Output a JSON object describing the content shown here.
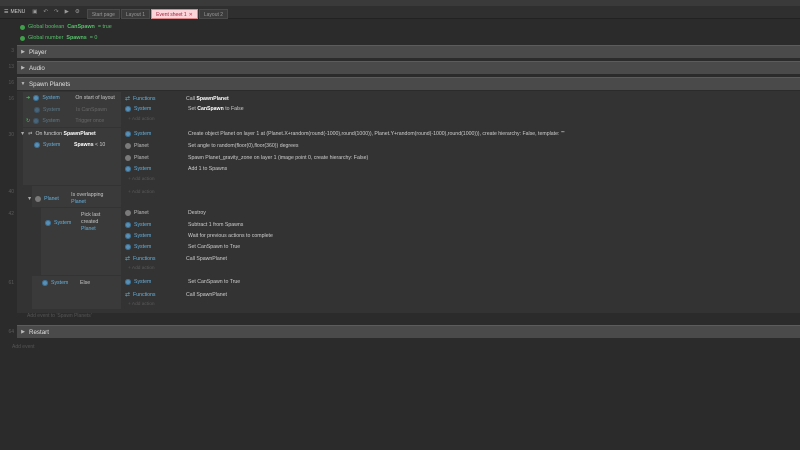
{
  "toolbar": {
    "menu_label": "MENU",
    "tabs": [
      "Start page",
      "Layout 1",
      "Event sheet 1",
      "Layout 2"
    ]
  },
  "globals": [
    {
      "text": "Global boolean ",
      "name": "CanSpawn",
      "value": " = true"
    },
    {
      "text": "Global number ",
      "name": "Spawns",
      "value": " = 0"
    }
  ],
  "line_numbers": {
    "g1": "3",
    "g2": "13",
    "g3": "16",
    "l1": "16",
    "l2": "30",
    "l3": "40",
    "l4": "42",
    "l5": "61",
    "l6": "64"
  },
  "groups": {
    "player": "Player",
    "audio": "Audio",
    "spawn": "Spawn Planets",
    "restart": "Restart"
  },
  "events": {
    "e1": {
      "conds": [
        {
          "obj": "System",
          "text": "On start of layout"
        },
        {
          "obj": "System",
          "text": "Is CanSpawn"
        },
        {
          "obj": "System",
          "text": "Trigger once"
        }
      ],
      "actions": [
        {
          "obj": "Functions",
          "pre": "Call ",
          "bold": "SpawnPlanet",
          "post": ""
        },
        {
          "obj": "System",
          "pre": "Set ",
          "bold": "CanSpawn",
          "post": " to False"
        }
      ]
    },
    "e2": {
      "header_pre": "On function ",
      "header_bold": "SpawnPlanet",
      "cond": {
        "obj": "System",
        "name": "Spawns",
        "op": " < 10"
      },
      "actions": [
        {
          "obj": "System",
          "text": "Create object  Planet on layer 1 at (Planet.X+random(round(-1000),round(1000)), Planet.Y+random(round(-1000),round(1000))), create hierarchy: False, template: \"\""
        },
        {
          "obj": "Planet",
          "text": "Set angle to random(floor(0),floor(360)) degrees"
        },
        {
          "obj": "Planet",
          "text": "Spawn     Planet_gravity_zone on layer 1 (image point 0, create hierarchy: False)"
        },
        {
          "obj": "System",
          "text": "Add 1 to Spawns"
        }
      ]
    },
    "e3": {
      "obj": "Planet",
      "text": "Is overlapping",
      "target": "Planet"
    },
    "e4": {
      "cond": {
        "obj": "System",
        "text": "Pick last created",
        "target": "Planet"
      },
      "actions": [
        {
          "obj": "Planet",
          "text": "Destroy"
        },
        {
          "obj": "System",
          "text": "Subtract 1 from Spawns"
        },
        {
          "obj": "System",
          "text": "Wait for previous actions to complete"
        },
        {
          "obj": "System",
          "text": "Set CanSpawn to True"
        },
        {
          "obj": "Functions",
          "text": "Call SpawnPlanet"
        }
      ]
    },
    "e5": {
      "cond": {
        "obj": "System",
        "text": "Else"
      },
      "actions": [
        {
          "obj": "System",
          "text": "Set CanSpawn to True"
        },
        {
          "obj": "Functions",
          "text": "Call SpawnPlanet"
        }
      ]
    }
  },
  "add_action": "+ Add action",
  "add_event_to": "Add event to 'Spawn Planets'",
  "add_event": "Add event"
}
